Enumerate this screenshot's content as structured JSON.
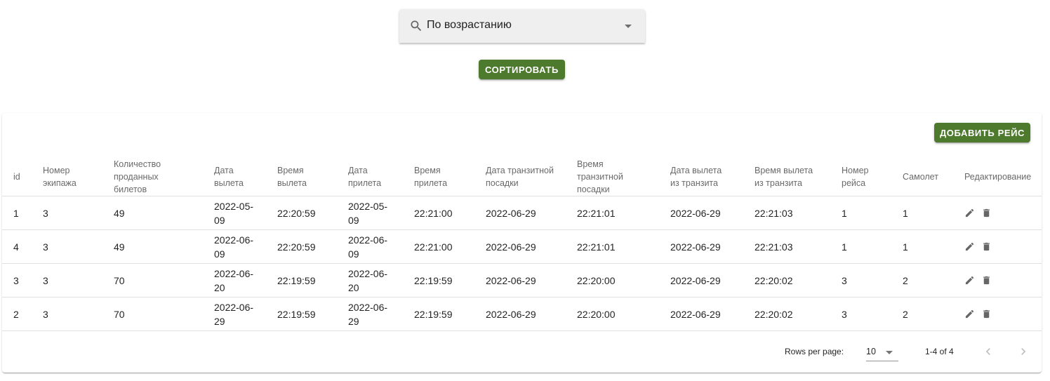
{
  "sort": {
    "selected": "По возрастанию",
    "button_label": "СОРТИРОВАТЬ"
  },
  "toolbar": {
    "add_label": "ДОБАВИТЬ РЕЙС"
  },
  "table": {
    "columns": [
      "id",
      "Номер экипажа",
      "Количество проданных билетов",
      "Дата вылета",
      "Время вылета",
      "Дата прилета",
      "Время прилета",
      "Дата транзитной посадки",
      "Время транзитной посадки",
      "Дата вылета из транзита",
      "Время вылета из транзита",
      "Номер рейса",
      "Самолет",
      "Редактирование"
    ],
    "rows": [
      [
        "1",
        "3",
        "49",
        "2022-05-09",
        "22:20:59",
        "2022-05-09",
        "22:21:00",
        "2022-06-29",
        "22:21:01",
        "2022-06-29",
        "22:21:03",
        "1",
        "1"
      ],
      [
        "4",
        "3",
        "49",
        "2022-06-09",
        "22:20:59",
        "2022-06-09",
        "22:21:00",
        "2022-06-29",
        "22:21:01",
        "2022-06-29",
        "22:21:03",
        "1",
        "1"
      ],
      [
        "3",
        "3",
        "70",
        "2022-06-20",
        "22:19:59",
        "2022-06-20",
        "22:19:59",
        "2022-06-29",
        "22:20:00",
        "2022-06-29",
        "22:20:02",
        "3",
        "2"
      ],
      [
        "2",
        "3",
        "70",
        "2022-06-29",
        "22:19:59",
        "2022-06-29",
        "22:19:59",
        "2022-06-29",
        "22:20:00",
        "2022-06-29",
        "22:20:02",
        "3",
        "2"
      ]
    ]
  },
  "pagination": {
    "rows_per_page_label": "Rows per page:",
    "rows_per_page": "10",
    "range": "1-4 of 4"
  },
  "colors": {
    "accent": "#4e7a2e"
  },
  "icons": {
    "search": "search-icon",
    "edit": "pencil-icon",
    "delete": "trash-icon",
    "prev": "chevron-left-icon",
    "next": "chevron-right-icon"
  }
}
